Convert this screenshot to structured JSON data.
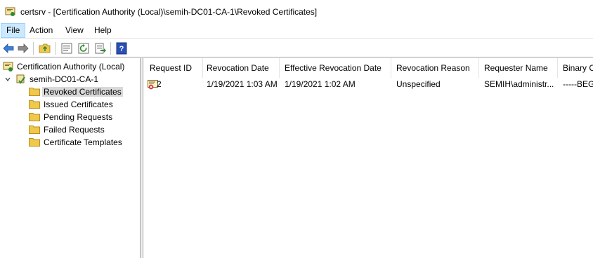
{
  "window": {
    "title": "certsrv - [Certification Authority (Local)\\semih-DC01-CA-1\\Revoked Certificates]"
  },
  "menu": {
    "items": [
      {
        "label": "File",
        "active": true
      },
      {
        "label": "Action"
      },
      {
        "label": "View"
      },
      {
        "label": "Help"
      }
    ]
  },
  "toolbar": {
    "buttons": [
      "back-arrow-icon",
      "forward-arrow-icon",
      "up-folder-icon",
      "properties-icon",
      "refresh-icon",
      "export-list-icon",
      "help-icon"
    ]
  },
  "tree": {
    "root": "Certification Authority (Local)",
    "ca": "semih-DC01-CA-1",
    "folders": [
      {
        "label": "Revoked Certificates",
        "selected": true
      },
      {
        "label": "Issued Certificates"
      },
      {
        "label": "Pending Requests"
      },
      {
        "label": "Failed Requests"
      },
      {
        "label": "Certificate Templates"
      }
    ]
  },
  "list": {
    "columns": [
      "Request ID",
      "Revocation Date",
      "Effective Revocation Date",
      "Revocation Reason",
      "Requester Name",
      "Binary C"
    ],
    "rows": [
      {
        "request_id": "2",
        "revocation_date": "1/19/2021 1:03 AM",
        "effective_revocation_date": "1/19/2021 1:02 AM",
        "revocation_reason": "Unspecified",
        "requester_name": "SEMIH\\administr...",
        "binary": "-----BEG"
      }
    ]
  },
  "colors": {
    "menu_active_bg": "#cce8ff",
    "selection_bg": "#d9d9d9",
    "folder_yellow": "#f0c84a"
  }
}
